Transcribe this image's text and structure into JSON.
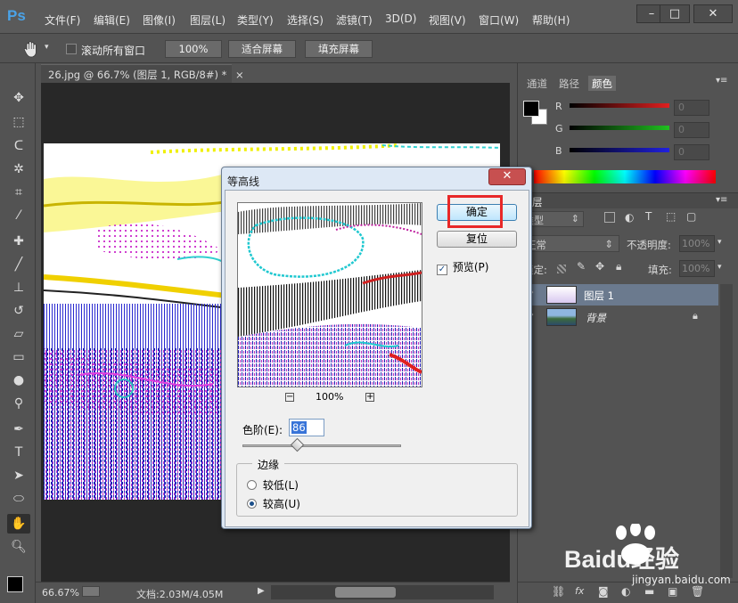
{
  "app": {
    "logo": "Ps"
  },
  "menu": [
    "文件(F)",
    "编辑(E)",
    "图像(I)",
    "图层(L)",
    "类型(Y)",
    "选择(S)",
    "滤镜(T)",
    "3D(D)",
    "视图(V)",
    "窗口(W)",
    "帮助(H)"
  ],
  "window_controls": {
    "minimize": "–",
    "restore": "□",
    "close": "✕"
  },
  "options": {
    "scroll_all_label": "滚动所有窗口",
    "zoom_btn": "100%",
    "fit_screen_btn": "适合屏幕",
    "fill_screen_btn": "填充屏幕"
  },
  "document": {
    "tab_title": "26.jpg @ 66.7% (图层 1, RGB/8#) *",
    "tab_close": "×"
  },
  "status": {
    "zoom": "66.67%",
    "doc_info": "文档:2.03M/4.05M"
  },
  "color_panel": {
    "tabs": [
      "通道",
      "路径",
      "颜色"
    ],
    "active_tab": "颜色",
    "channels": [
      {
        "label": "R",
        "value": "0",
        "color": "#e02020"
      },
      {
        "label": "G",
        "value": "0",
        "color": "#20c020"
      },
      {
        "label": "B",
        "value": "0",
        "color": "#2020e0"
      }
    ]
  },
  "layers_panel": {
    "tab": "层",
    "kind_filter": "类型",
    "blend_mode": "正常",
    "opacity_label": "不透明度:",
    "opacity_value": "100%",
    "lock_label": "锁定:",
    "fill_label": "填充:",
    "fill_value": "100%",
    "layers": [
      {
        "name": "图层 1",
        "selected": true
      },
      {
        "name": "背景",
        "italic": true,
        "locked": true
      }
    ]
  },
  "dialog": {
    "title": "等高线",
    "ok_label": "确定",
    "reset_label": "复位",
    "preview_label": "预览(P)",
    "preview_checked": true,
    "zoom_minus": "−",
    "zoom_value": "100%",
    "zoom_plus": "+",
    "level_label": "色阶(E):",
    "level_value": "86",
    "level_max": 255,
    "edge_group": "边缘",
    "edge_options": [
      "较低(L)",
      "较高(U)"
    ],
    "edge_selected": "较高(U)"
  },
  "watermark": {
    "brand": "Baidu经验",
    "url": "jingyan.baidu.com"
  }
}
